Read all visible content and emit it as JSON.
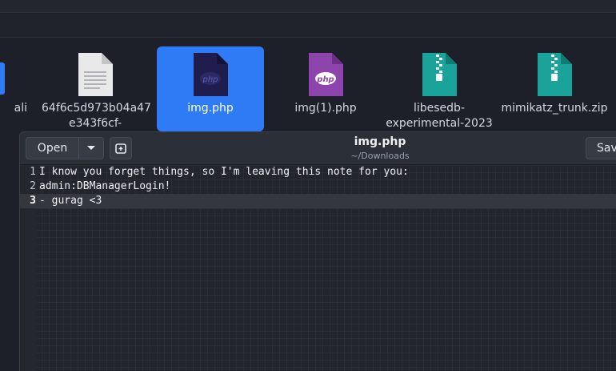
{
  "file_manager": {
    "files": [
      {
        "label_lines": [
          "ali"
        ],
        "icon": "folder-icon",
        "selected": false
      },
      {
        "label_lines": [
          "64f6c5d973b04a47",
          "e343f6cf-"
        ],
        "icon": "text-file-icon",
        "selected": false
      },
      {
        "label_lines": [
          "img.php"
        ],
        "icon": "php-file-icon",
        "selected": true
      },
      {
        "label_lines": [
          "img(1).php"
        ],
        "icon": "php-file-icon",
        "selected": false
      },
      {
        "label_lines": [
          "libesedb-",
          "experimental-2023"
        ],
        "icon": "zip-archive-icon",
        "selected": false
      },
      {
        "label_lines": [
          "mimikatz_trunk.zip"
        ],
        "icon": "zip-archive-icon",
        "selected": false
      }
    ],
    "php_badge": "php"
  },
  "editor": {
    "open_label": "Open",
    "title": "img.php",
    "subtitle": "~/Downloads",
    "save_label": "Save",
    "current_line": 3,
    "lines": [
      {
        "num": "1",
        "text": "I know you forget things, so I'm leaving this note for you:"
      },
      {
        "num": "2",
        "text": "admin:DBManagerLogin!"
      },
      {
        "num": "3",
        "text": "- gurag <3"
      }
    ]
  },
  "colors": {
    "selection": "#2f7bf5",
    "php_icon_dark": "#1e1d4d",
    "php_icon_purple": "#8e44ad",
    "zip_teal": "#1aa39a"
  }
}
